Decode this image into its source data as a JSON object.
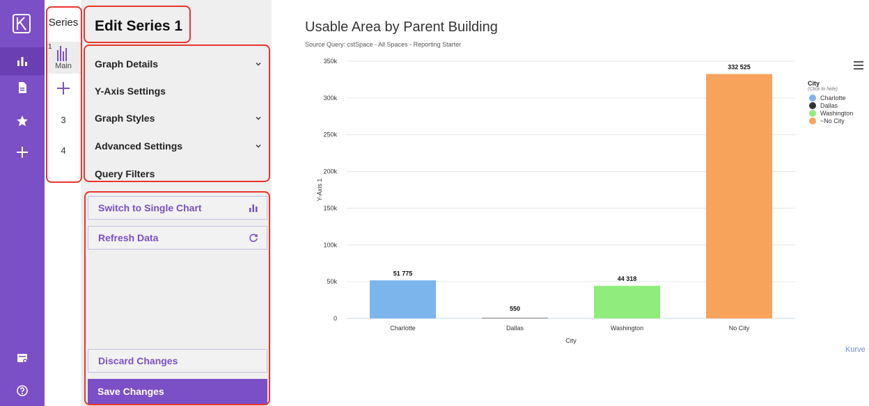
{
  "series": {
    "title": "Series",
    "main": {
      "number": "1",
      "label": "Main"
    },
    "items": [
      "3",
      "4"
    ]
  },
  "panel": {
    "title": "Edit Series 1",
    "sections": [
      {
        "label": "Graph Details",
        "expandable": true
      },
      {
        "label": "Y-Axis Settings",
        "expandable": false
      },
      {
        "label": "Graph Styles",
        "expandable": true
      },
      {
        "label": "Advanced Settings",
        "expandable": true
      },
      {
        "label": "Query Filters",
        "expandable": false
      }
    ],
    "switch_label": "Switch to Single Chart",
    "refresh_label": "Refresh Data",
    "discard_label": "Discard Changes",
    "save_label": "Save Changes"
  },
  "chart": {
    "title": "Usable Area by Parent Building",
    "subtitle": "Source Query: cstSpace - All Spaces - Reporting Starter",
    "legend_title": "City",
    "legend_hint": "(Click to hide)",
    "credit": "Kurve"
  },
  "colors": {
    "accent": "#7b4fc6",
    "charlotte": "#7cb4ec",
    "dallas": "#333333",
    "washington": "#90ed7d",
    "no_city": "#f7a35c",
    "annotation": "#e8352b"
  },
  "chart_data": {
    "type": "bar",
    "title": "Usable Area by Parent Building",
    "xlabel": "City",
    "ylabel": "Y-Axis 1",
    "categories": [
      "Charlotte",
      "Dallas",
      "Washington",
      "No City"
    ],
    "values": [
      51775,
      550,
      44318,
      332525
    ],
    "value_labels": [
      "51 775",
      "550",
      "44 318",
      "332 525"
    ],
    "colors": [
      "#7cb4ec",
      "#333333",
      "#90ed7d",
      "#f7a35c"
    ],
    "legend": [
      "Charlotte",
      "Dallas",
      "Washington",
      "~No City"
    ],
    "ylim": [
      0,
      350000
    ],
    "yticks": [
      0,
      50000,
      100000,
      150000,
      200000,
      250000,
      300000,
      350000
    ],
    "ytick_labels": [
      "0",
      "50k",
      "100k",
      "150k",
      "200k",
      "250k",
      "300k",
      "350k"
    ],
    "grid": true,
    "legend_position": "right"
  }
}
